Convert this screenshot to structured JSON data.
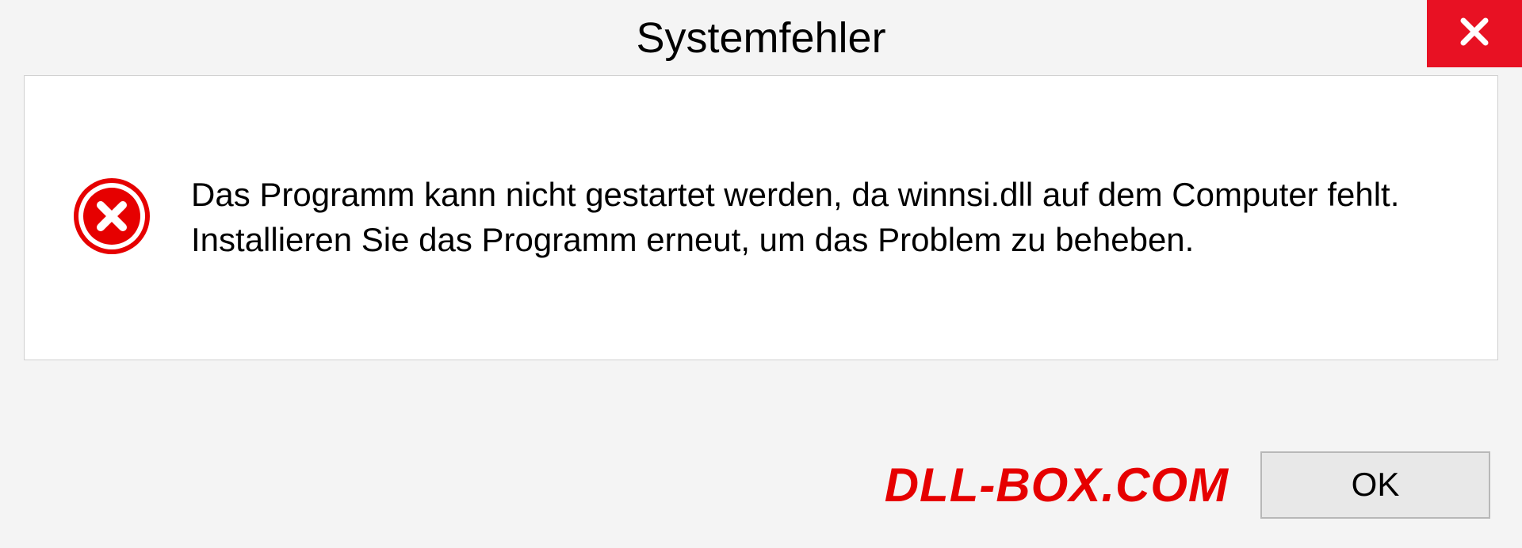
{
  "dialog": {
    "title": "Systemfehler",
    "message": "Das Programm kann nicht gestartet werden, da winnsi.dll auf dem Computer fehlt. Installieren Sie das Programm erneut, um das Problem zu beheben.",
    "ok_label": "OK"
  },
  "watermark": "DLL-BOX.COM"
}
